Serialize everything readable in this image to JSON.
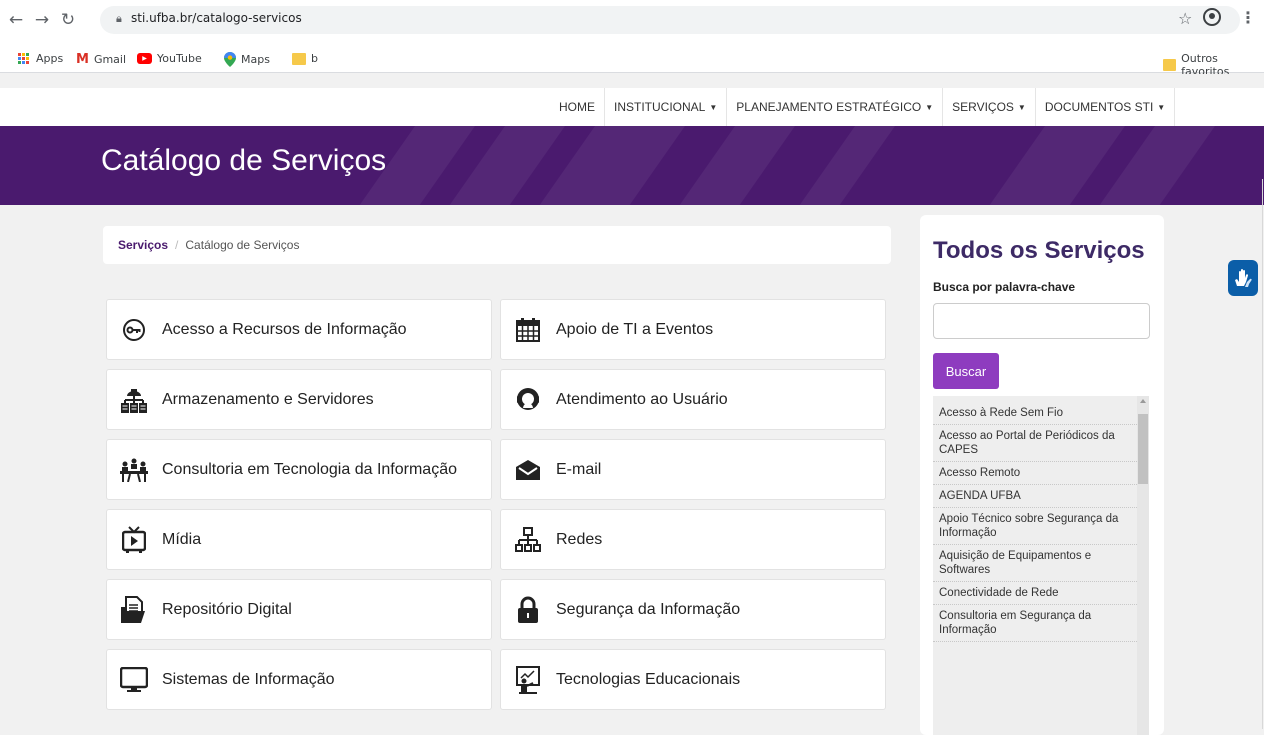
{
  "browser": {
    "url": "sti.ufba.br/catalogo-servicos",
    "bookmarks": [
      {
        "label": "Apps",
        "icon": "apps-grid-icon"
      },
      {
        "label": "Gmail",
        "icon": "gmail-icon"
      },
      {
        "label": "YouTube",
        "icon": "youtube-icon"
      },
      {
        "label": "Maps",
        "icon": "maps-pin-icon"
      },
      {
        "label": "b",
        "icon": "folder-icon"
      }
    ],
    "other_bookmarks": "Outros favoritos",
    "colors": {
      "folder": "#f6c94a",
      "gmail": "#d93025",
      "youtube": "#ff0000"
    }
  },
  "nav": {
    "items": [
      {
        "label": "HOME",
        "dropdown": false
      },
      {
        "label": "INSTITUCIONAL",
        "dropdown": true
      },
      {
        "label": "PLANEJAMENTO ESTRATÉGICO",
        "dropdown": true
      },
      {
        "label": "SERVIÇOS",
        "dropdown": true
      },
      {
        "label": "DOCUMENTOS STI",
        "dropdown": true
      }
    ]
  },
  "banner": {
    "title": "Catálogo de Serviços",
    "color": "#4a1a6e"
  },
  "breadcrumb": {
    "root": "Serviços",
    "separator": "/",
    "current": "Catálogo de Serviços"
  },
  "services": [
    {
      "label": "Acesso a Recursos de Informação",
      "icon": "key-icon"
    },
    {
      "label": "Apoio de TI a Eventos",
      "icon": "calendar-icon"
    },
    {
      "label": "Armazenamento e Servidores",
      "icon": "server-network-icon"
    },
    {
      "label": "Atendimento ao Usuário",
      "icon": "headset-user-icon"
    },
    {
      "label": "Consultoria em Tecnologia da Informação",
      "icon": "meeting-icon"
    },
    {
      "label": "E-mail",
      "icon": "envelope-icon"
    },
    {
      "label": "Mídia",
      "icon": "tv-play-icon"
    },
    {
      "label": "Redes",
      "icon": "network-icon"
    },
    {
      "label": "Repositório Digital",
      "icon": "folder-documents-icon"
    },
    {
      "label": "Segurança da Informação",
      "icon": "lock-icon"
    },
    {
      "label": "Sistemas de Informação",
      "icon": "monitor-icon"
    },
    {
      "label": "Tecnologias Educacionais",
      "icon": "teacher-board-icon"
    }
  ],
  "sidebar": {
    "title": "Todos os Serviços",
    "search_label": "Busca por palavra-chave",
    "search_value": "",
    "button_label": "Buscar",
    "button_color": "#8e3cbf",
    "items": [
      "Acesso à Rede Sem Fio",
      "Acesso ao Portal de Periódicos da CAPES",
      "Acesso Remoto",
      "AGENDA UFBA",
      "Apoio Técnico sobre Segurança da Informação",
      "Aquisição de Equipamentos e Softwares",
      "Conectividade de Rede",
      "Consultoria em Segurança da Informação"
    ]
  },
  "accessibility": {
    "icon": "vlibras-hands-icon",
    "color": "#0b5ea8"
  }
}
